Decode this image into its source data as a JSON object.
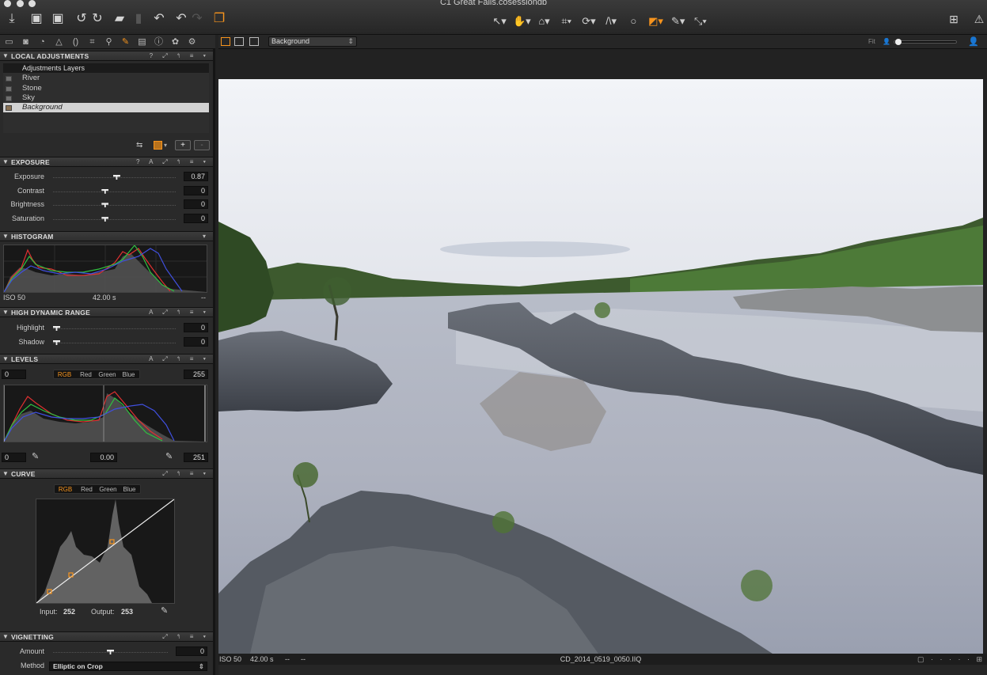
{
  "window": {
    "title": "C1 Great Falls.cosessiondb"
  },
  "toolbar": {
    "left_icons": [
      "import-icon",
      "capture-icon",
      "capture-alt-icon",
      "rotate-left-icon",
      "rotate-right-icon",
      "folder-icon",
      "trash-icon",
      "undo-icon",
      "undo-alt-icon",
      "redo-icon",
      "stack-icon"
    ],
    "cursor_tools": [
      "select-cursor-icon",
      "pan-icon",
      "loupe-icon",
      "crop-icon",
      "rotate-tool-icon",
      "keystone-icon",
      "spot-removal-icon",
      "mask-brush-icon",
      "color-picker-icon",
      "apply-icon"
    ],
    "right_icons": [
      "layout-icon",
      "warning-icon"
    ]
  },
  "tool_tabs": [
    "library-icon",
    "capture-tab-icon",
    "lens-icon",
    "color-icon",
    "exposure-icon",
    "composition-icon",
    "details-icon",
    "local-adjustments-icon",
    "metadata-icon",
    "output-icon",
    "batch-icon",
    "settings-icon",
    "quick-icon"
  ],
  "viewer": {
    "layer_select": "Background",
    "zoom_label": "Fit"
  },
  "local_adjustments": {
    "title": "LOCAL ADJUSTMENTS",
    "controls": "? ⤢ ↰ ≡ ▾",
    "layers_header": "Adjustments Layers",
    "layers": [
      "River",
      "Stone",
      "Sky",
      "Background"
    ],
    "selected_layer": "Background",
    "add_label": "+",
    "remove_label": "-"
  },
  "exposure": {
    "title": "EXPOSURE",
    "controls": "? A ⤢ ↰ ≡ ▾",
    "rows": [
      {
        "label": "Exposure",
        "value": "0.87",
        "pos": 0.52
      },
      {
        "label": "Contrast",
        "value": "0",
        "pos": 0.42
      },
      {
        "label": "Brightness",
        "value": "0",
        "pos": 0.42
      },
      {
        "label": "Saturation",
        "value": "0",
        "pos": 0.42
      }
    ]
  },
  "histogram": {
    "title": "HISTOGRAM",
    "iso": "ISO 50",
    "shutter": "42.00 s",
    "aperture": "--"
  },
  "hdr": {
    "title": "HIGH DYNAMIC RANGE",
    "controls": "A ⤢ ↰ ≡ ▾",
    "rows": [
      {
        "label": "Highlight",
        "value": "0",
        "pos": 0.0
      },
      {
        "label": "Shadow",
        "value": "0",
        "pos": 0.0
      }
    ]
  },
  "levels": {
    "title": "LEVELS",
    "controls": "A ⤢ ↰ ≡ ▾",
    "in_low": "0",
    "in_high": "255",
    "out_low": "0",
    "mid": "0.00",
    "out_high": "251",
    "channels": [
      "RGB",
      "Red",
      "Green",
      "Blue"
    ],
    "active_channel": "RGB"
  },
  "curve": {
    "title": "CURVE",
    "controls": "⤢ ↰ ≡ ▾",
    "channels": [
      "RGB",
      "Red",
      "Green",
      "Blue"
    ],
    "active_channel": "RGB",
    "input_label": "Input:",
    "input_value": "252",
    "output_label": "Output:",
    "output_value": "253"
  },
  "vignetting": {
    "title": "VIGNETTING",
    "controls": "⤢ ↰ ≡ ▾",
    "amount_label": "Amount",
    "amount_value": "0",
    "amount_pos": 0.5,
    "method_label": "Method",
    "method_value": "Elliptic on Crop"
  },
  "status": {
    "iso": "ISO 50",
    "shutter": "42.00 s",
    "aperture": "--",
    "extra": "--",
    "filename": "CD_2014_0519_0050.IIQ"
  },
  "colors": {
    "accent": "#f7941d",
    "histogram_red": "#e03030",
    "histogram_green": "#30c040",
    "histogram_blue": "#4050e0"
  }
}
